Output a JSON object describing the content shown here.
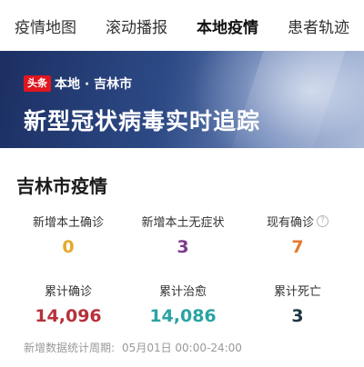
{
  "tabs": [
    {
      "label": "疫情地图"
    },
    {
      "label": "滚动播报"
    },
    {
      "label": "本地疫情",
      "active": true
    },
    {
      "label": "患者轨迹"
    }
  ],
  "banner": {
    "badge": "头条",
    "location": "本地 · 吉林市",
    "headline": "新型冠状病毒实时追踪"
  },
  "section": {
    "title": "吉林市疫情"
  },
  "stats": [
    {
      "label": "新增本土确诊",
      "value": "0",
      "color": "#e5a92b"
    },
    {
      "label": "新增本土无症状",
      "value": "3",
      "color": "#7f3b8c"
    },
    {
      "label": "现有确诊",
      "value": "7",
      "color": "#e57a2e",
      "help_icon": "question-circle-icon"
    },
    {
      "label": "累计确诊",
      "value": "14,096",
      "color": "#b6313b"
    },
    {
      "label": "累计治愈",
      "value": "14,086",
      "color": "#2aa3a3"
    },
    {
      "label": "累计死亡",
      "value": "3",
      "color": "#1f3644"
    }
  ],
  "footer": {
    "label": "新增数据统计周期:",
    "date": "05月01日 00:00-24:00"
  }
}
